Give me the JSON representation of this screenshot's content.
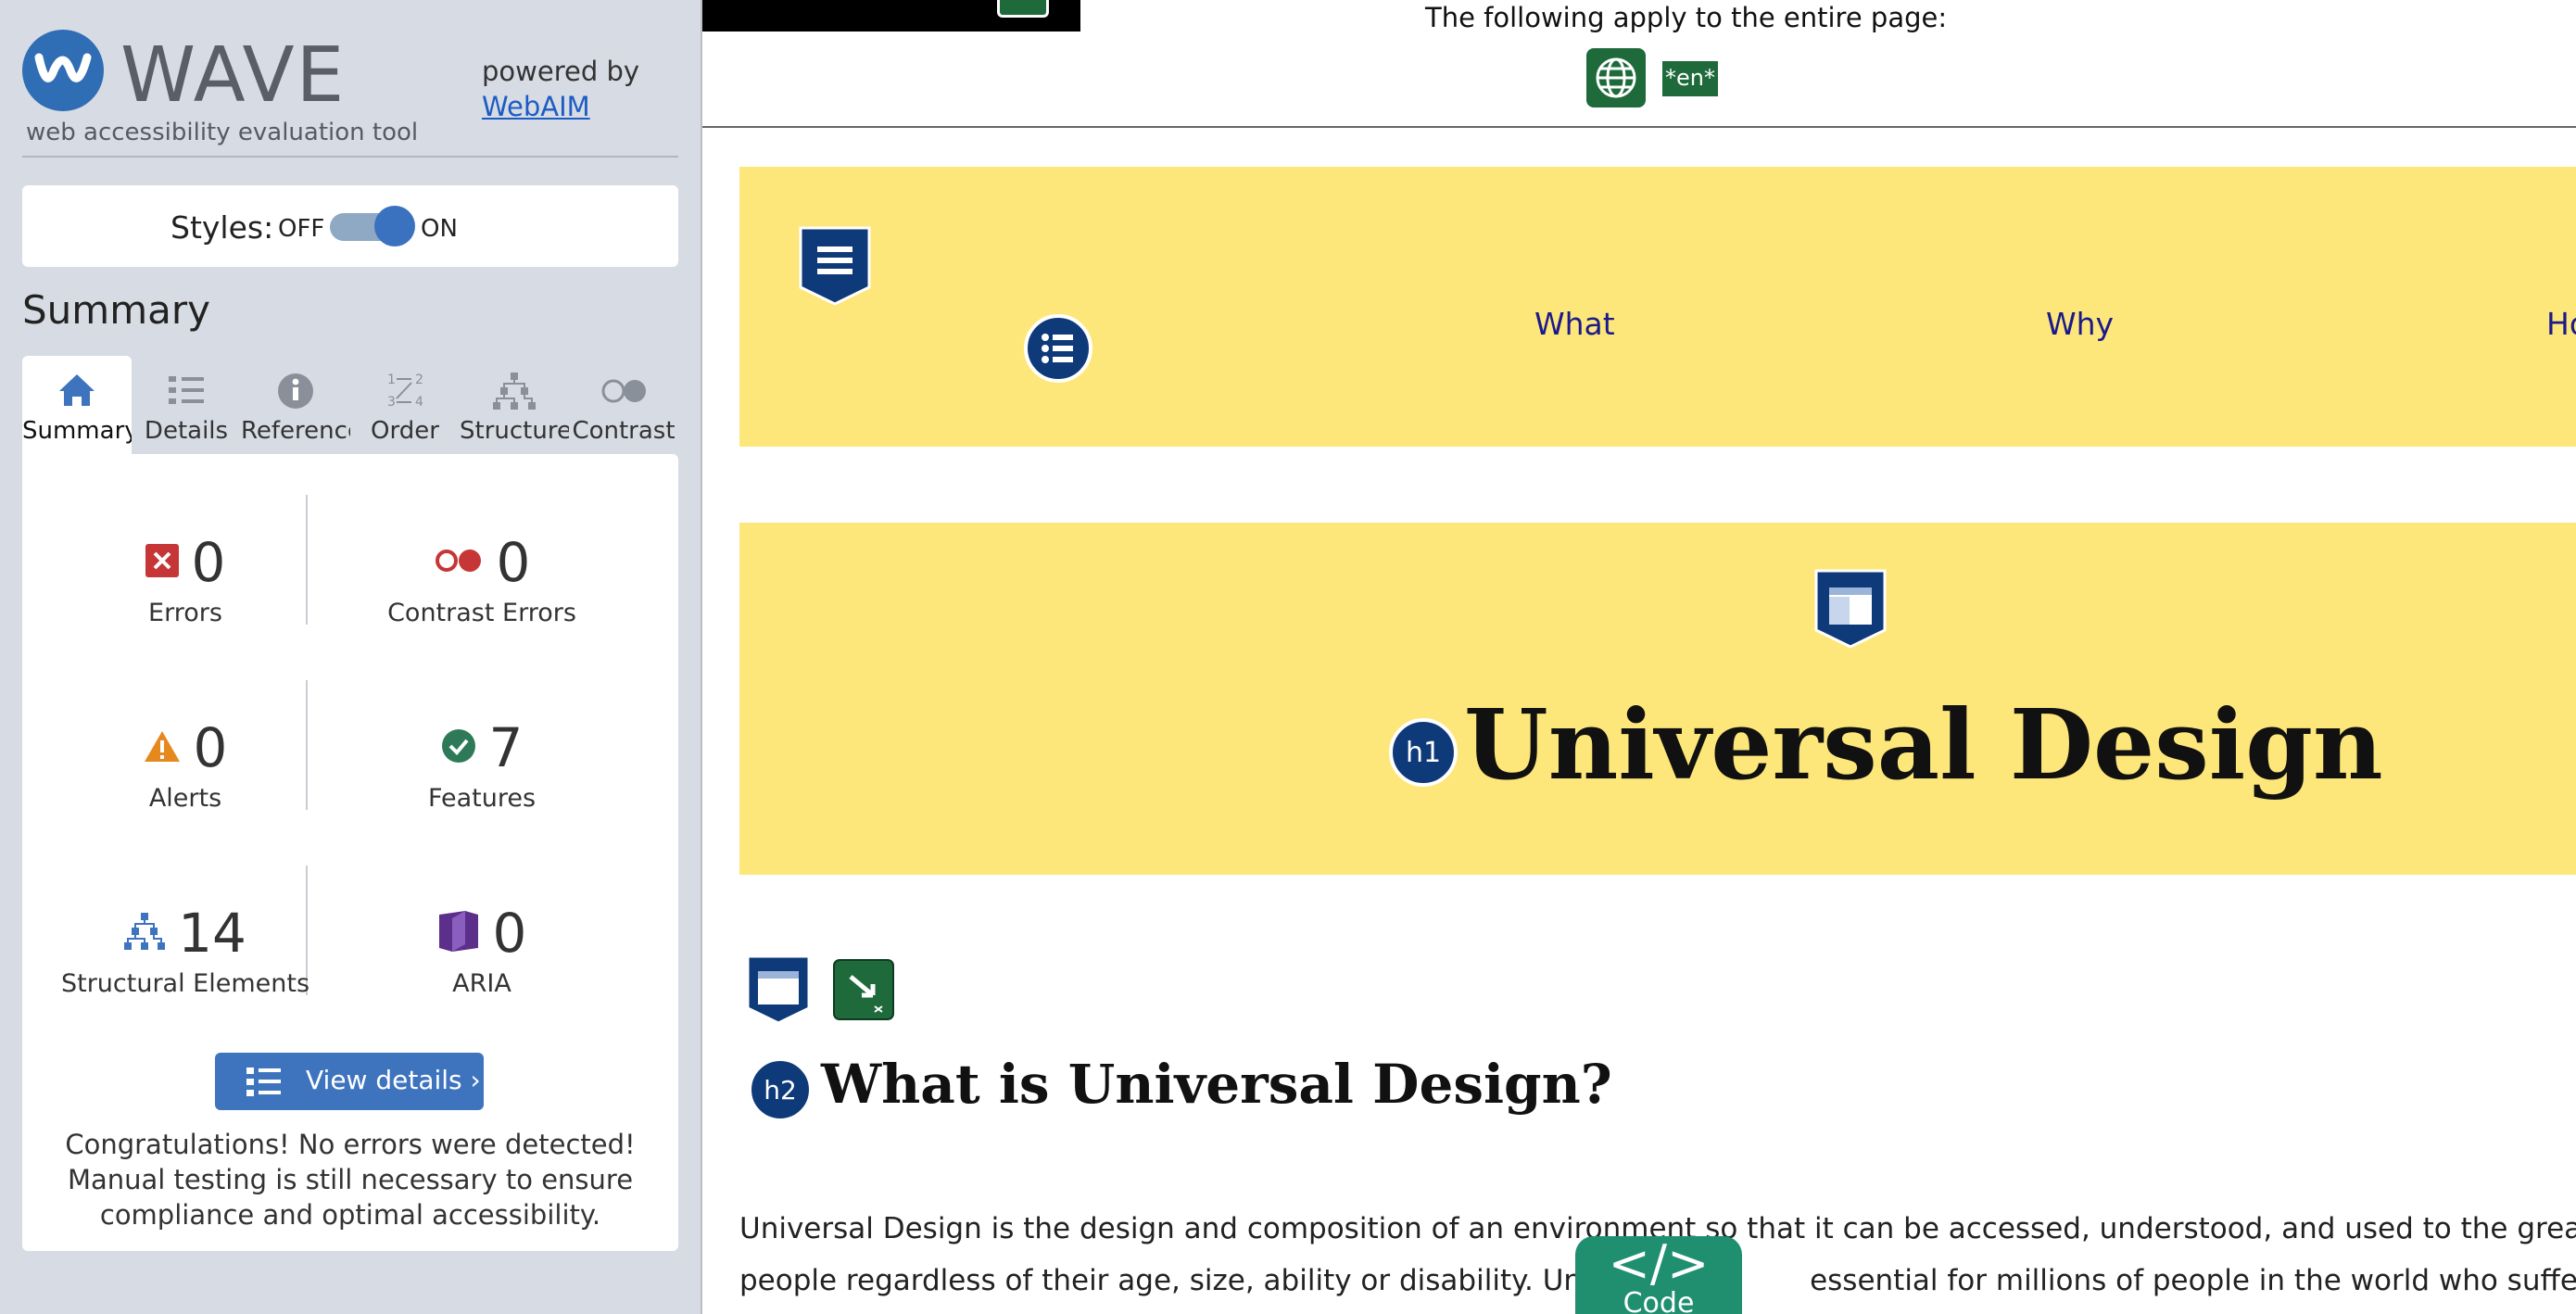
{
  "sidebar": {
    "logo_title": "WAVE",
    "logo_subtitle": "web accessibility evaluation tool",
    "powered_by": "powered by",
    "webaim_link": "WebAIM",
    "styles_label": "Styles:",
    "styles_off": "OFF",
    "styles_on": "ON",
    "styles_enabled": true,
    "summary_heading": "Summary",
    "tabs": [
      {
        "label": "Summary",
        "icon": "home-icon",
        "active": true
      },
      {
        "label": "Details",
        "icon": "list-icon",
        "active": false
      },
      {
        "label": "Reference",
        "icon": "info-icon",
        "active": false
      },
      {
        "label": "Order",
        "icon": "order-icon",
        "active": false
      },
      {
        "label": "Structure",
        "icon": "structure-icon",
        "active": false
      },
      {
        "label": "Contrast",
        "icon": "contrast-icon",
        "active": false
      }
    ],
    "stats": {
      "errors": {
        "value": "0",
        "label": "Errors"
      },
      "contrast_errors": {
        "value": "0",
        "label": "Contrast Errors"
      },
      "alerts": {
        "value": "0",
        "label": "Alerts"
      },
      "features": {
        "value": "7",
        "label": "Features"
      },
      "structural": {
        "value": "14",
        "label": "Structural Elements"
      },
      "aria": {
        "value": "0",
        "label": "ARIA"
      }
    },
    "view_details": "View details ›",
    "congrats": "Congratulations! No errors were detected! Manual testing is still necessary to ensure compliance and optimal accessibility."
  },
  "page": {
    "notice": "The following apply to the entire page:",
    "lang_badge": "*en*",
    "nav": [
      "What",
      "Why",
      "Ho"
    ],
    "h1_badge": "h1",
    "h1": "Universal Design",
    "h2_badge": "h2",
    "h2": "What is Universal Design?",
    "para_line1": "Universal Design is the design and composition of an environment so that it can be accessed, understood, and used to the greatest ext",
    "para_line2": "people regardless of their age, size, ability or disability. Univer                   essential for millions of people in the world who suffer from d",
    "code_label": "Code",
    "code_symbol": "</>"
  },
  "colors": {
    "accent_blue": "#3e74be",
    "yellow_band": "#fee77a",
    "feature_green": "#1e6a3a",
    "error_red": "#c63636",
    "alert_orange": "#e5891f",
    "aria_purple": "#5b2f8a"
  }
}
